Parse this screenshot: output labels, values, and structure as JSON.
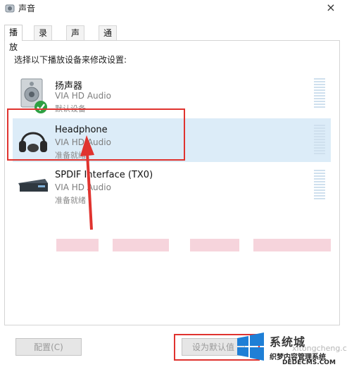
{
  "window": {
    "title": "声音",
    "close_glyph": "×",
    "icon": "speaker-icon"
  },
  "tabs": [
    {
      "label": "播放",
      "active": true
    },
    {
      "label": "录制",
      "active": false
    },
    {
      "label": "声音",
      "active": false
    },
    {
      "label": "通信",
      "active": false
    }
  ],
  "panel": {
    "instructions": "选择以下播放设备来修改设置:"
  },
  "devices": [
    {
      "name": "扬声器",
      "driver": "VIA HD Audio",
      "status": "默认设备",
      "icon": "speaker-device-icon",
      "default": true,
      "selected": false
    },
    {
      "name": "Headphone",
      "driver": "VIA HD Audio",
      "status": "准备就绪",
      "icon": "headphone-icon",
      "default": false,
      "selected": true
    },
    {
      "name": "SPDIF Interface (TX0)",
      "driver": "VIA HD Audio",
      "status": "准备就绪",
      "icon": "spdif-device-icon",
      "default": false,
      "selected": false
    }
  ],
  "buttons": {
    "configure": "配置(C)",
    "set_default": "设为默认值"
  },
  "watermark": {
    "main": "系统城",
    "sub": "织梦内容管理系统",
    "site": "DEDECMS.COM",
    "faint": "xitongcheng.com"
  },
  "colors": {
    "selected_row": "#dcecf8",
    "annotation_red": "#e0332f",
    "check_green": "#2ea043"
  }
}
